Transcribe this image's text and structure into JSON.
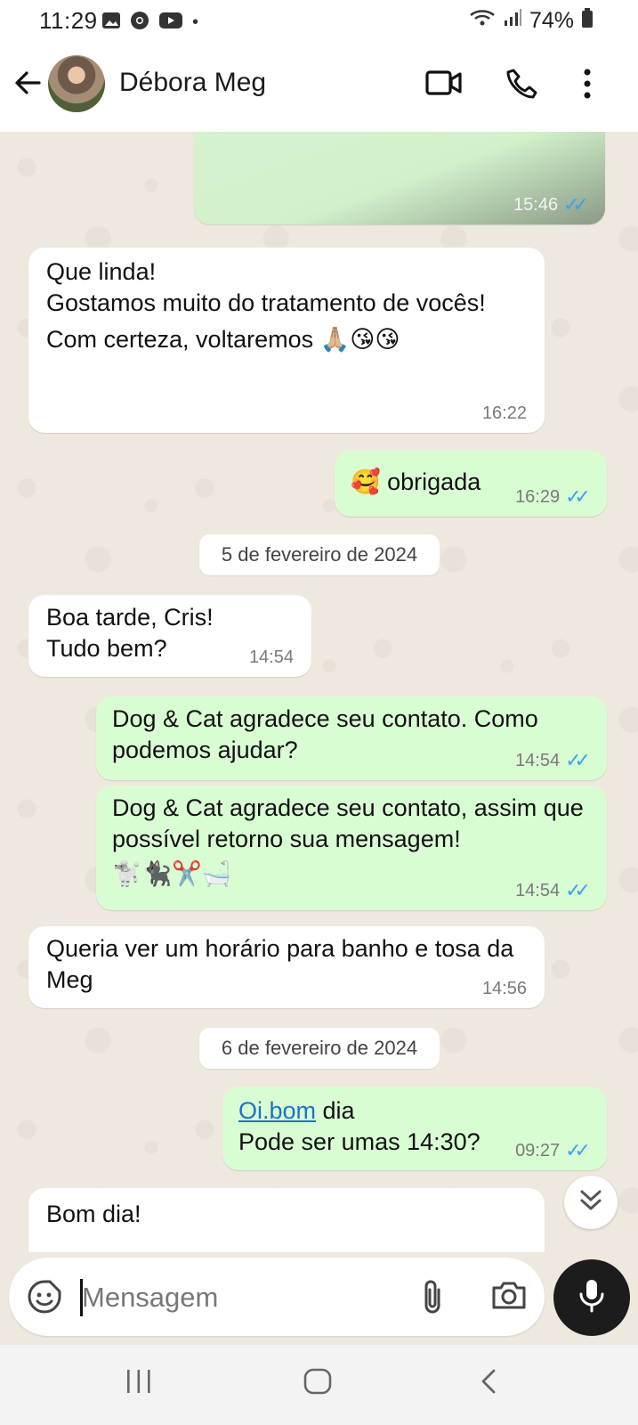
{
  "status_bar": {
    "time": "11:29",
    "dot": "•",
    "battery": "74%"
  },
  "header": {
    "contact_name": "Débora Meg"
  },
  "messages": [
    {
      "dir": "out",
      "time": "15:46"
    },
    {
      "dir": "in",
      "lines": [
        "Que linda!",
        "Gostamos muito do tratamento de vocês!",
        "Com certeza, voltaremos"
      ],
      "emoji": "🙏🏼😘😘",
      "time": "16:22"
    },
    {
      "dir": "out",
      "emoji": "🥰",
      "text": "obrigada",
      "time": "16:29"
    },
    {
      "dir": "in",
      "lines": [
        "Boa tarde, Cris!",
        "Tudo bem?"
      ],
      "time": "14:54"
    },
    {
      "dir": "out",
      "text": "Dog & Cat agradece seu contato. Como podemos ajudar?",
      "time": "14:54"
    },
    {
      "dir": "out",
      "text": "Dog & Cat agradece seu contato, assim que possível retorno sua mensagem!",
      "emoji": "🐩🐈‍⬛✂️🛁",
      "time": "14:54"
    },
    {
      "dir": "in",
      "text": "Queria ver um horário para banho e tosa da Meg",
      "time": "14:56"
    },
    {
      "dir": "out",
      "link": "Oi.bom",
      "after_link": " dia",
      "line2": "Pode ser umas 14:30?",
      "time": "09:27"
    },
    {
      "dir": "in",
      "text": "Bom dia!"
    }
  ],
  "dates": [
    "5 de fevereiro de 2024",
    "6 de fevereiro de 2024"
  ],
  "composer": {
    "placeholder": "Mensagem"
  }
}
